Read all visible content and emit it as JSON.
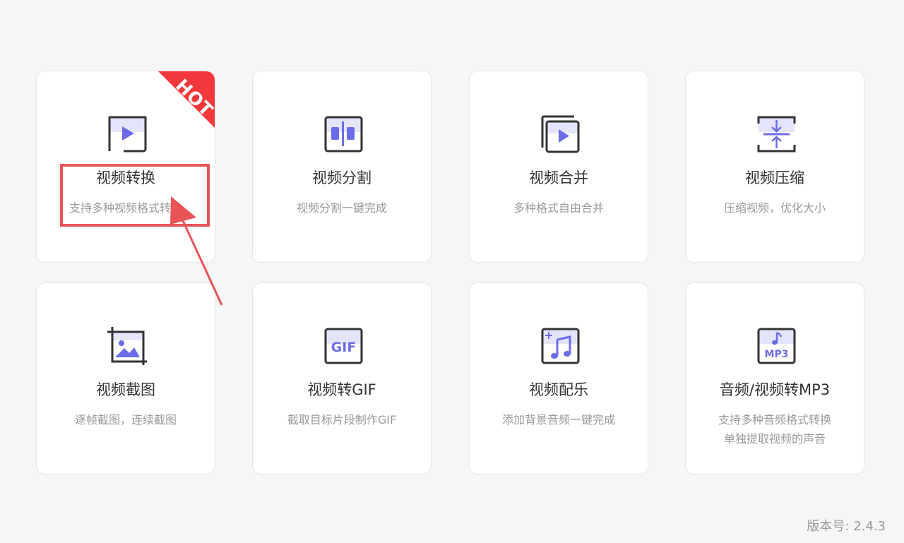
{
  "cards": [
    {
      "title": "视频转换",
      "desc": "支持多种视频格式转换",
      "icon": "video-convert-icon",
      "badge": "HOT"
    },
    {
      "title": "视频分割",
      "desc": "视频分割一键完成",
      "icon": "video-split-icon"
    },
    {
      "title": "视频合并",
      "desc": "多种格式自由合并",
      "icon": "video-merge-icon"
    },
    {
      "title": "视频压缩",
      "desc": "压缩视频，优化大小",
      "icon": "video-compress-icon"
    },
    {
      "title": "视频截图",
      "desc": "逐帧截图，连续截图",
      "icon": "video-screenshot-icon"
    },
    {
      "title": "视频转GIF",
      "desc": "截取目标片段制作GIF",
      "icon": "gif-icon",
      "icon_text": "GIF"
    },
    {
      "title": "视频配乐",
      "desc": "添加背景音频一键完成",
      "icon": "music-add-icon"
    },
    {
      "title": "音频/视频转MP3",
      "desc": "支持多种音频格式转换",
      "desc2": "单独提取视频的声音",
      "icon": "mp3-icon",
      "icon_text": "MP3"
    }
  ],
  "version": "版本号: 2.4.3",
  "colors": {
    "background": "#f6f6f8",
    "card": "#ffffff",
    "icon_accent": "#6c6cea",
    "icon_fill": "#e4e4fb",
    "icon_stroke": "#333333",
    "hot_badge": "#f0383d",
    "annotation": "#e85457",
    "title_text": "#333333",
    "desc_text": "#999999"
  }
}
